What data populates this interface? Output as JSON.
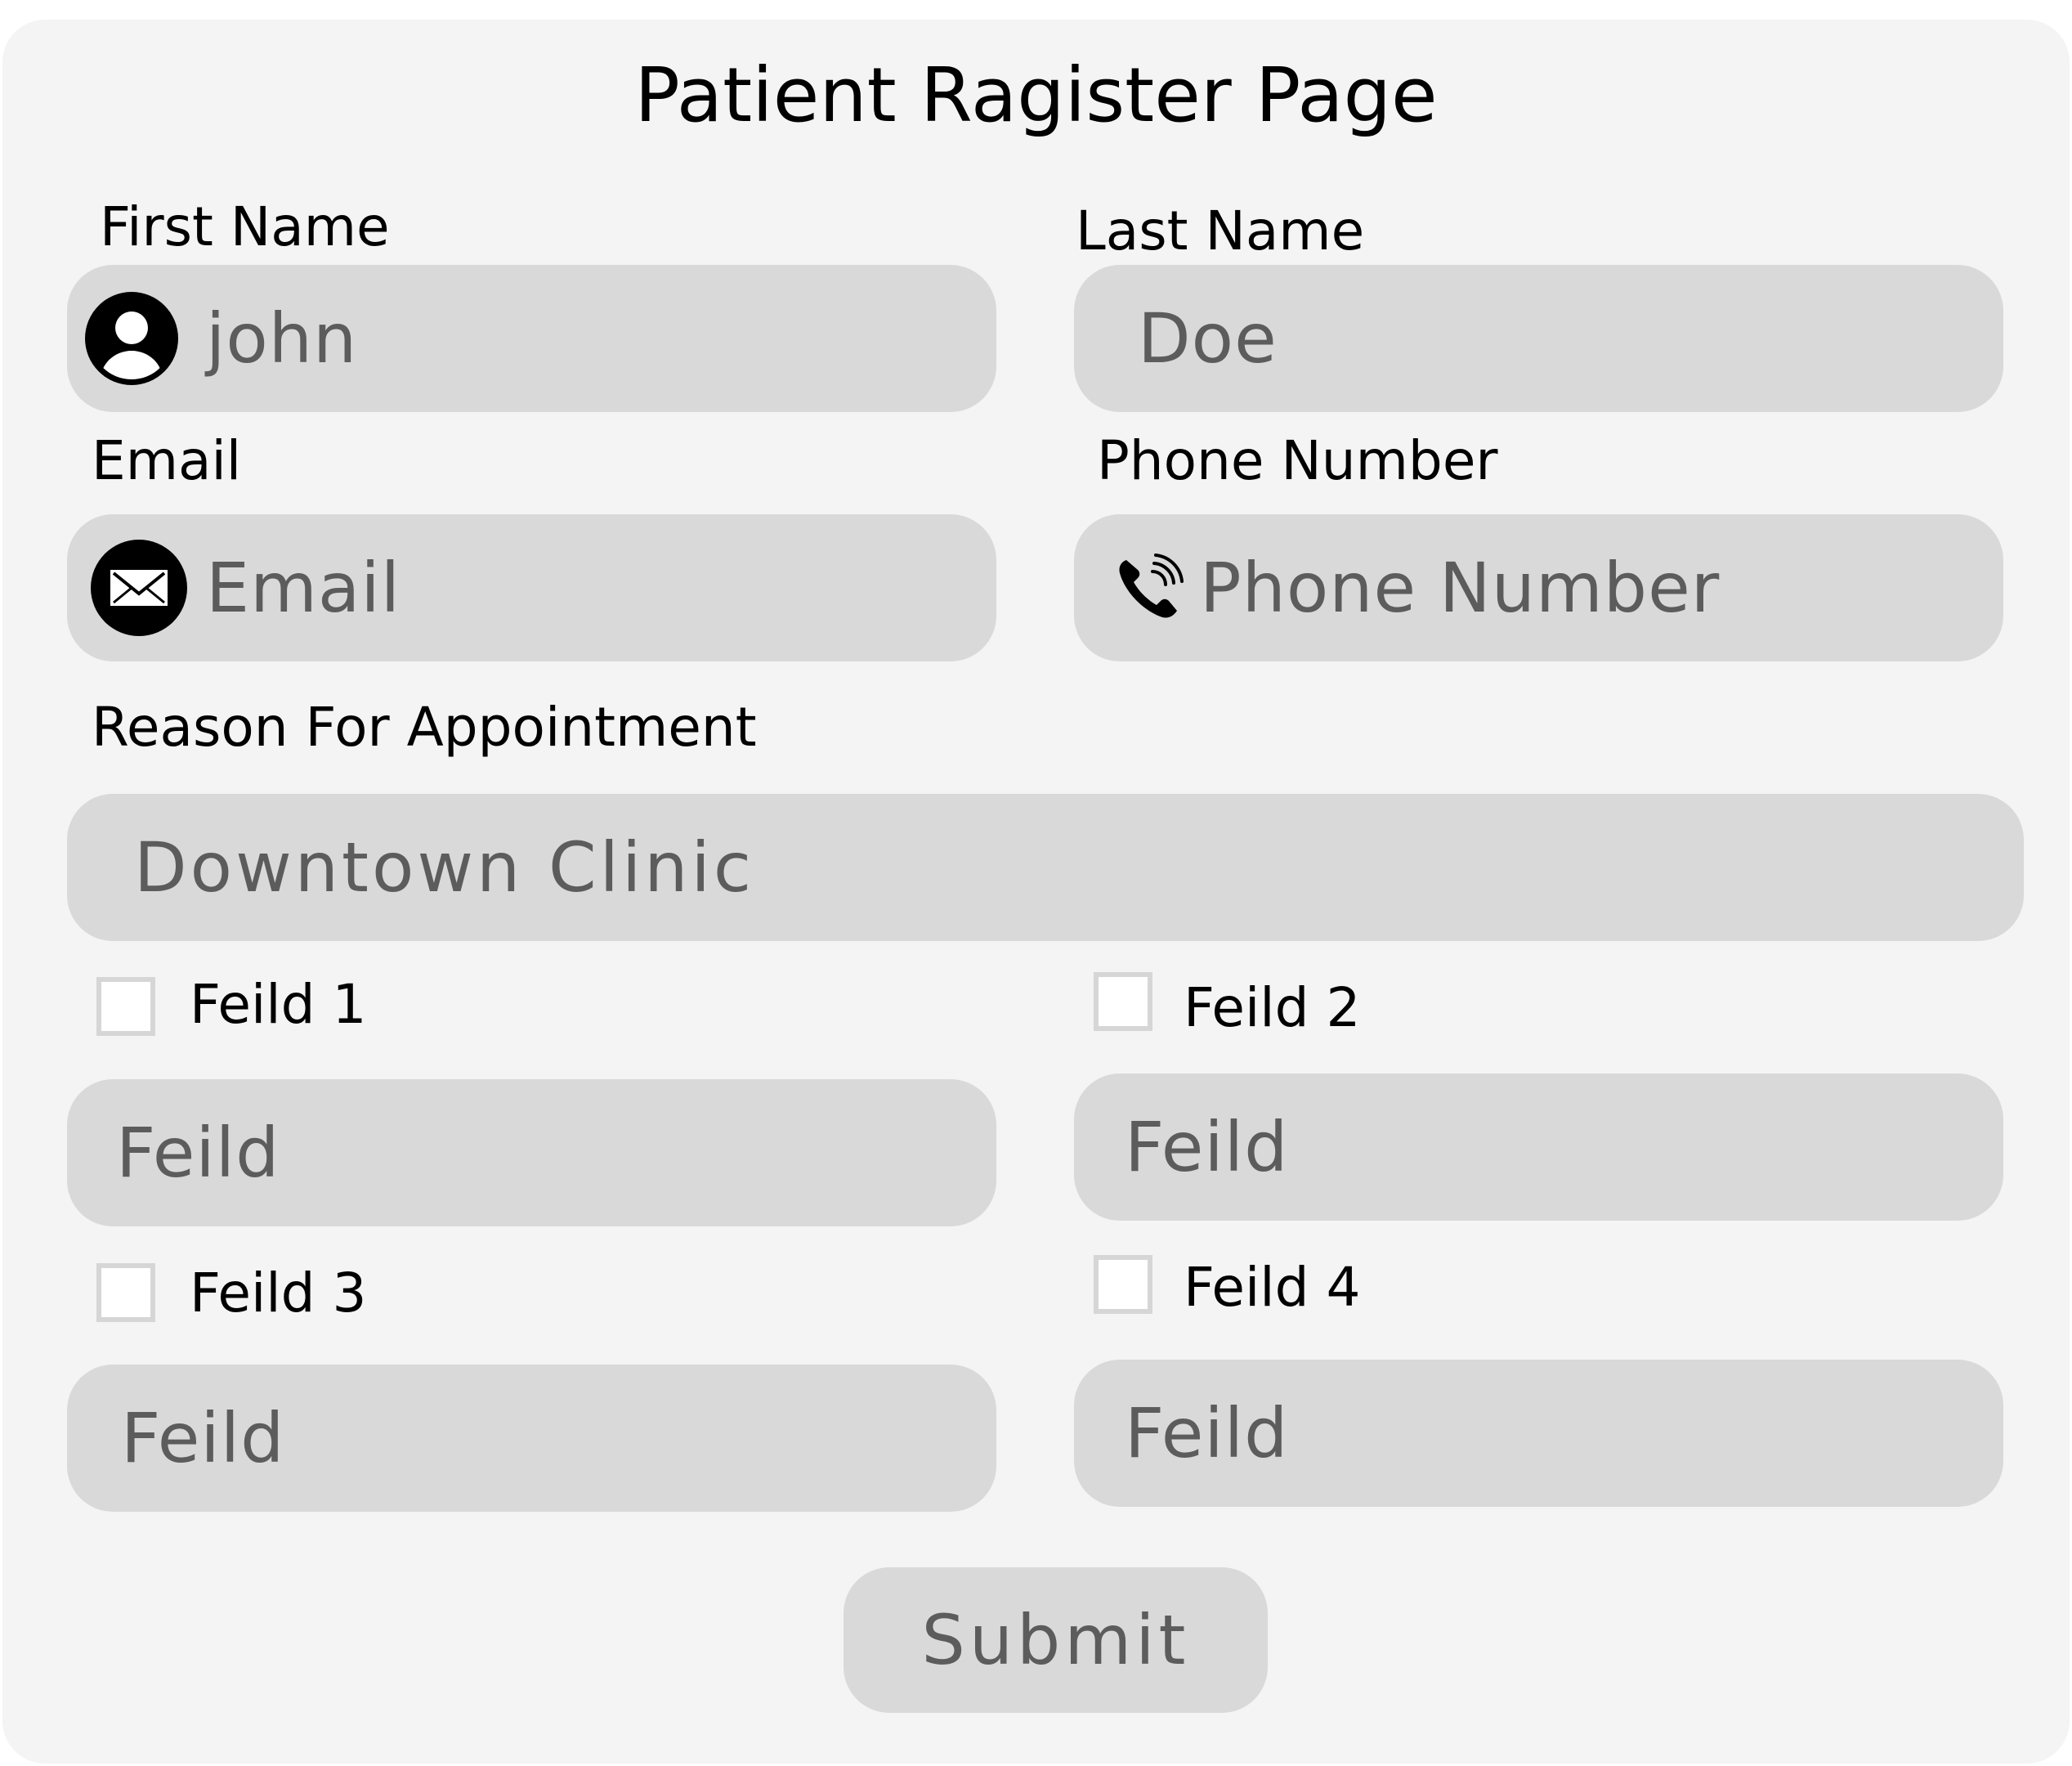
{
  "page": {
    "title": "Patient Ragister Page"
  },
  "form": {
    "first_name": {
      "label": "First Name",
      "placeholder": "john",
      "icon": "user-circle-icon"
    },
    "last_name": {
      "label": "Last Name",
      "placeholder": "Doe"
    },
    "email": {
      "label": "Email",
      "placeholder": "Email",
      "icon": "envelope-icon"
    },
    "phone": {
      "label": "Phone Number",
      "placeholder": "Phone Number",
      "icon": "phone-icon"
    },
    "reason": {
      "label": "Reason For Appointment",
      "placeholder": "Downtown Clinic"
    },
    "optional_fields": [
      {
        "label": "Feild 1",
        "placeholder": "Feild",
        "checked": false
      },
      {
        "label": "Feild 2",
        "placeholder": "Feild",
        "checked": false
      },
      {
        "label": "Feild 3",
        "placeholder": "Feild",
        "checked": false
      },
      {
        "label": "Feild 4",
        "placeholder": "Feild",
        "checked": false
      }
    ],
    "submit_label": "Submit"
  },
  "colors": {
    "card_background": "#f4f4f4",
    "field_background": "#d9d9d9",
    "placeholder_text": "#5c5c5c",
    "checkbox_border": "#d6d6d6"
  }
}
